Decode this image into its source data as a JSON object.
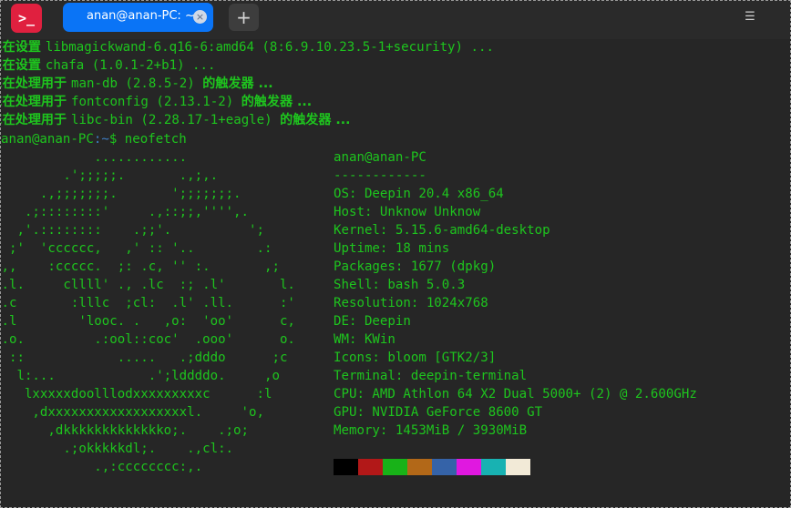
{
  "window": {
    "tab_title": "anan@anan-PC: ~",
    "app_icon_glyph": ">_",
    "close_glyph": "×",
    "new_tab_glyph": "+",
    "menu_glyph": "☰"
  },
  "output_lines": [
    {
      "prefix": "E在设置 ",
      "text": "libmagickwand-6.q16-6:amd64 (8:6.9.10.23.5-1+security) ...",
      "suffix": ""
    },
    {
      "prefix": "E在设置 ",
      "text": "chafa (1.0.1-2+b1) ...",
      "suffix": ""
    },
    {
      "prefix": "E在处理用于 ",
      "text": "man-db (2.8.5-2) ",
      "suffix": "的触发器 ..."
    },
    {
      "prefix": "E在处理用于 ",
      "text": "fontconfig (2.13.1-2) ",
      "suffix": "的触发器 ..."
    },
    {
      "prefix": "E在处理用于 ",
      "text": "libc-bin (2.28.17-1+eagle) ",
      "suffix": "的触发器 ..."
    }
  ],
  "prompt": {
    "host": "anan@anan-PC",
    "path": ":~",
    "symbol": "$ ",
    "command": "neofetch"
  },
  "ascii_art": [
    "             ............",
    "         .';;;;;.       .,;,.",
    "      .,;;;;;;;.       ';;;;;;;.",
    "    .;::::::::'     .,::;;,'''',.",
    "   ,'.::::::::    .;;'.          ';",
    "  ;'  'cccccc,   ,' :: '..        .:",
    " ,,    :ccccc.  ;: .c, '' :.       ,;",
    " .l.     cllll' ., .lc  :; .l'       l.",
    " .c       :lllc  ;cl:  .l' .ll.      :'",
    " .l        'looc. .   ,o:  'oo'      c,",
    " .o.         .:ool::coc'  .ooo'      o.",
    "  ::            .....   .;dddo      ;c",
    "   l:...            .';lddddo.     ,o",
    "    lxxxxxdoolllodxxxxxxxxxc      :l",
    "     ,dxxxxxxxxxxxxxxxxxxl.     'o,",
    "       ,dkkkkkkkkkkkkko;.    .;o;",
    "         .;okkkkkdl;.    .,cl:.",
    "             .,:cccccccc:,."
  ],
  "info": {
    "user_host": "anan@anan-PC",
    "separator": "------------",
    "rows": [
      "OS: Deepin 20.4 x86_64",
      "Host: Unknow Unknow",
      "Kernel: 5.15.6-amd64-desktop",
      "Uptime: 18 mins",
      "Packages: 1677 (dpkg)",
      "Shell: bash 5.0.3",
      "Resolution: 1024x768",
      "DE: Deepin",
      "WM: KWin",
      "Icons: bloom [GTK2/3]",
      "Terminal: deepin-terminal",
      "CPU: AMD Athlon 64 X2 Dual 5000+ (2) @ 2.600GHz",
      "GPU: NVIDIA GeForce 8600 GT",
      "Memory: 1453MiB / 3930MiB"
    ]
  },
  "colors": {
    "terminal_green": "#1ec51e",
    "path_blue": "#3f7fc4",
    "tab_blue": "#0a74f6",
    "app_icon_red": "#e0203f",
    "palette": [
      "#000000",
      "#b21818",
      "#18b218",
      "#b26818",
      "#3563a8",
      "#e018e0",
      "#18b2b2",
      "#f2ead7"
    ]
  }
}
